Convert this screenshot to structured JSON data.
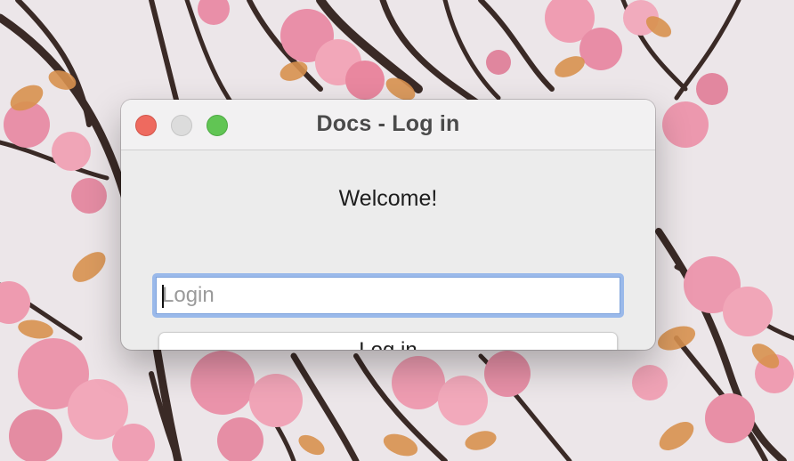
{
  "window": {
    "title": "Docs - Log in"
  },
  "content": {
    "welcome_text": "Welcome!",
    "login_placeholder": "Login",
    "login_value": "",
    "login_button_label": "Log in"
  },
  "colors": {
    "close": "#ee6a5f",
    "minimize": "#dcdcdc",
    "zoom": "#61c554",
    "focus_ring": "#9ab9ea"
  }
}
